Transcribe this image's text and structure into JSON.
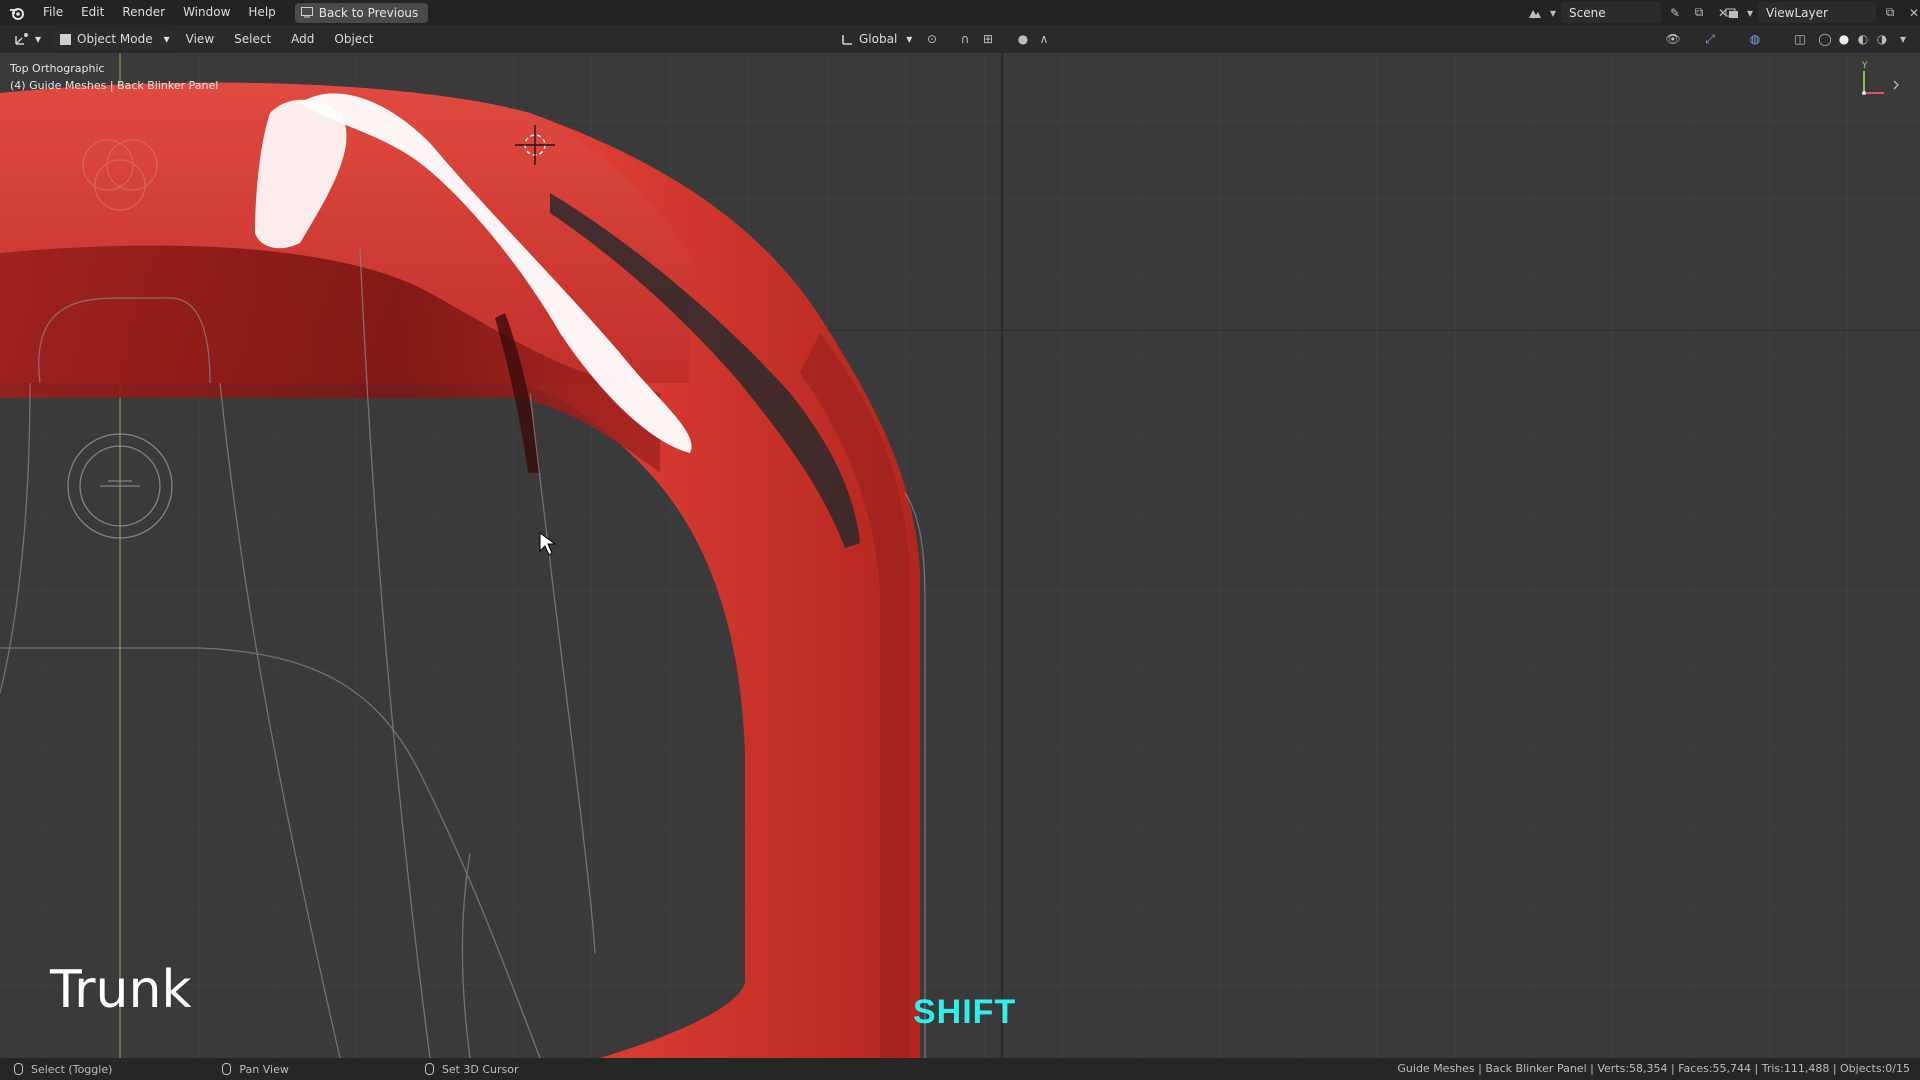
{
  "topbar": {
    "menu": [
      "File",
      "Edit",
      "Window",
      "Render",
      "Help"
    ],
    "menu_items": {
      "file": "File",
      "edit": "Edit",
      "render": "Render",
      "window": "Window",
      "help": "Help"
    },
    "back_button": "Back to Previous",
    "scene_name": "Scene",
    "view_layer": "ViewLayer"
  },
  "header": {
    "mode": "Object Mode",
    "view": "View",
    "select": "Select",
    "add": "Add",
    "object": "Object",
    "orientation": "Global"
  },
  "viewport": {
    "view_name": "Top Orthographic",
    "collection_info": "(4) Guide Meshes | Back Blinker Panel",
    "axis_y": "Y",
    "caption_trunk": "Trunk",
    "caption_key": "SHIFT"
  },
  "statusbar": {
    "hint_select": "Select (Toggle)",
    "hint_pan": "Pan View",
    "hint_cursor": "Set 3D Cursor",
    "stats": "Guide Meshes | Back Blinker Panel | Verts:58,354 | Faces:55,744 | Tris:111,488 | Objects:0/15"
  },
  "colors": {
    "car_red": "#d63a32",
    "key_caption": "#2ef0ee",
    "grid_bg": "#3a3a3a"
  }
}
